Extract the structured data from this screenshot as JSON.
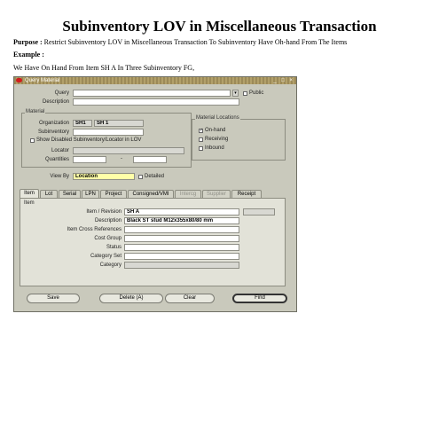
{
  "doc": {
    "title": "Subinventory LOV in Miscellaneous Transaction",
    "purpose_label": "Purpose :",
    "purpose_text": " Restrict Subinventory LOV in Miscellaneous Transaction To Subinventory Have Oh-hand From The Items",
    "example_label": "Example :",
    "example_text": "We Have On Hand From Item SH A In Three Subinventory FG,"
  },
  "window": {
    "title": "Query Material",
    "controls": "_ □ ×",
    "query_label": "Query",
    "query_value": "",
    "public_label": "Public",
    "description_label": "Description",
    "description_value": "",
    "material_group": "Material",
    "organization_label": "Organization",
    "organization_code": "SH1",
    "organization_name": "SH 1",
    "subinventory_label": "Subinventory",
    "subinventory_value": "",
    "show_disabled_label": "Show Disabled Subinventory/Locator in LOV",
    "locator_label": "Locator",
    "quantities_label": "Quantities",
    "quantities_sep": "-",
    "view_by_label": "View By",
    "view_by_value": "Location",
    "detailed_label": "Detailed",
    "locations_group": "Material Locations",
    "location_options": [
      {
        "label": "On-hand",
        "checked": true
      },
      {
        "label": "Receiving",
        "checked": false
      },
      {
        "label": "Inbound",
        "checked": false
      }
    ]
  },
  "tabs": [
    {
      "label": "Item",
      "active": true,
      "enabled": true
    },
    {
      "label": "Lot",
      "active": false,
      "enabled": true
    },
    {
      "label": "Serial",
      "active": false,
      "enabled": true
    },
    {
      "label": "LPN",
      "active": false,
      "enabled": true
    },
    {
      "label": "Project",
      "active": false,
      "enabled": true
    },
    {
      "label": "Consigned/VMI",
      "active": false,
      "enabled": true
    },
    {
      "label": "Intercg",
      "active": false,
      "enabled": false
    },
    {
      "label": "Supplier",
      "active": false,
      "enabled": false
    },
    {
      "label": "Receipt",
      "active": false,
      "enabled": true
    }
  ],
  "item_panel": {
    "heading": "Item",
    "fields": [
      {
        "label": "Item / Revision",
        "value": "SH A"
      },
      {
        "label": "Description",
        "value": "Black ST stud M12x355x80/80 mm"
      },
      {
        "label": "Item Cross References",
        "value": ""
      },
      {
        "label": "Cost Group",
        "value": ""
      },
      {
        "label": "Status",
        "value": ""
      },
      {
        "label": "Category Set",
        "value": ""
      },
      {
        "label": "Category",
        "value": ""
      }
    ]
  },
  "buttons": {
    "save": "Save",
    "delete": "Delete (A)",
    "clear": "Clear",
    "find": "Find"
  }
}
